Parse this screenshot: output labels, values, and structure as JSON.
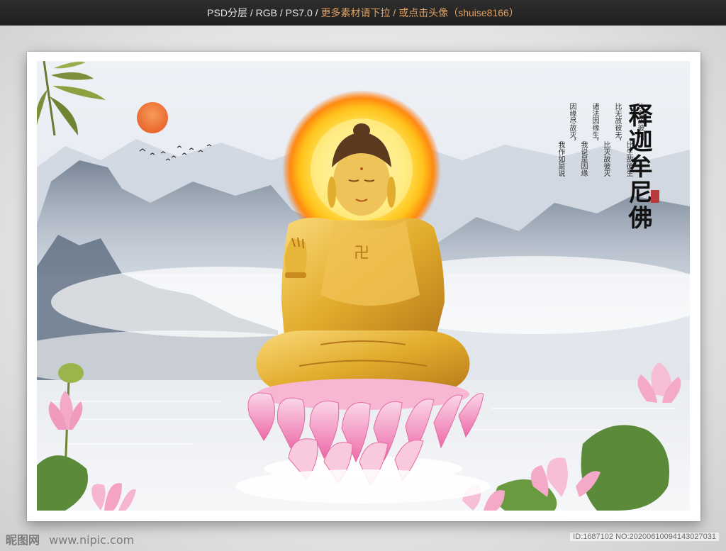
{
  "header": {
    "info_text": "PSD分层 / RGB / PS7.0 / ",
    "more_text": "更多素材请下拉 / 或点击头像（shuise8166）"
  },
  "artwork": {
    "title": "释迦牟尼佛",
    "verse_columns": [
      "比有故彼有，",
      "比生故彼生",
      "比无故彼无，",
      "比灭故彼灭",
      "诸法因缘生，",
      "我说是因缘",
      "因缘尽故灭，",
      "我作如是说"
    ],
    "chest_symbol": "卍"
  },
  "footer": {
    "site_logo": "昵图网",
    "site_url": "www.nipic.com",
    "id_text": "ID:1687102 NO:20200610094143027031"
  },
  "colors": {
    "halo": "#ffd21a",
    "gold": "#e2ac2c",
    "lotus_pink": "#f28bbd",
    "leaf_green": "#5b8a3a",
    "sun": "#f07b3a"
  }
}
